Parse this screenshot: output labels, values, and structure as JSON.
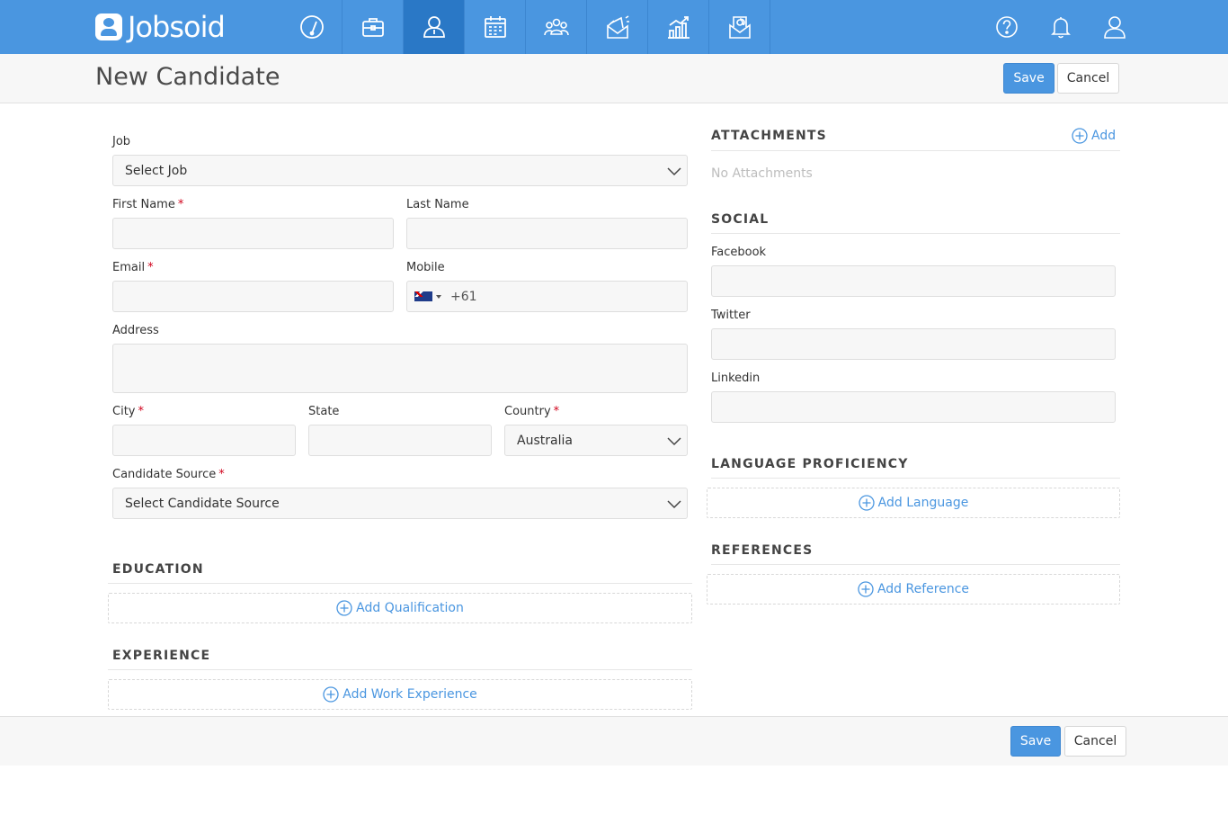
{
  "app": {
    "brand": "Jobsoid"
  },
  "nav": {
    "items": [
      {
        "icon": "dashboard-icon"
      },
      {
        "icon": "briefcase-icon"
      },
      {
        "icon": "candidate-icon"
      },
      {
        "icon": "calendar-icon"
      },
      {
        "icon": "team-icon"
      },
      {
        "icon": "campaign-icon"
      },
      {
        "icon": "reports-icon"
      },
      {
        "icon": "email-icon"
      }
    ],
    "active_index": 2,
    "right_icons": [
      "help-icon",
      "bell-icon",
      "user-icon"
    ]
  },
  "header": {
    "title": "New Candidate",
    "save_label": "Save",
    "cancel_label": "Cancel"
  },
  "form": {
    "job": {
      "label": "Job",
      "value": "Select Job"
    },
    "first_name": {
      "label": "First Name",
      "value": ""
    },
    "last_name": {
      "label": "Last Name",
      "value": ""
    },
    "email": {
      "label": "Email",
      "value": ""
    },
    "mobile": {
      "label": "Mobile",
      "code": "+61"
    },
    "address": {
      "label": "Address",
      "value": ""
    },
    "city": {
      "label": "City",
      "value": ""
    },
    "state": {
      "label": "State",
      "value": ""
    },
    "country": {
      "label": "Country",
      "value": "Australia"
    },
    "source": {
      "label": "Candidate Source",
      "value": "Select Candidate Source"
    },
    "required_marker": "*"
  },
  "education": {
    "title": "EDUCATION",
    "add_label": "Add Qualification"
  },
  "experience": {
    "title": "EXPERIENCE",
    "add_label": "Add Work Experience"
  },
  "attachments": {
    "title": "ATTACHMENTS",
    "add_label": "Add",
    "empty_text": "No Attachments"
  },
  "social": {
    "title": "SOCIAL",
    "facebook_label": "Facebook",
    "twitter_label": "Twitter",
    "linkedin_label": "Linkedin"
  },
  "language": {
    "title": "LANGUAGE PROFICIENCY",
    "add_label": "Add Language"
  },
  "references": {
    "title": "REFERENCES",
    "add_label": "Add Reference"
  },
  "footer": {
    "save_label": "Save",
    "cancel_label": "Cancel"
  },
  "colors": {
    "brand": "#4a96e0",
    "brand_active": "#2a78c6",
    "required": "#d0021b"
  }
}
